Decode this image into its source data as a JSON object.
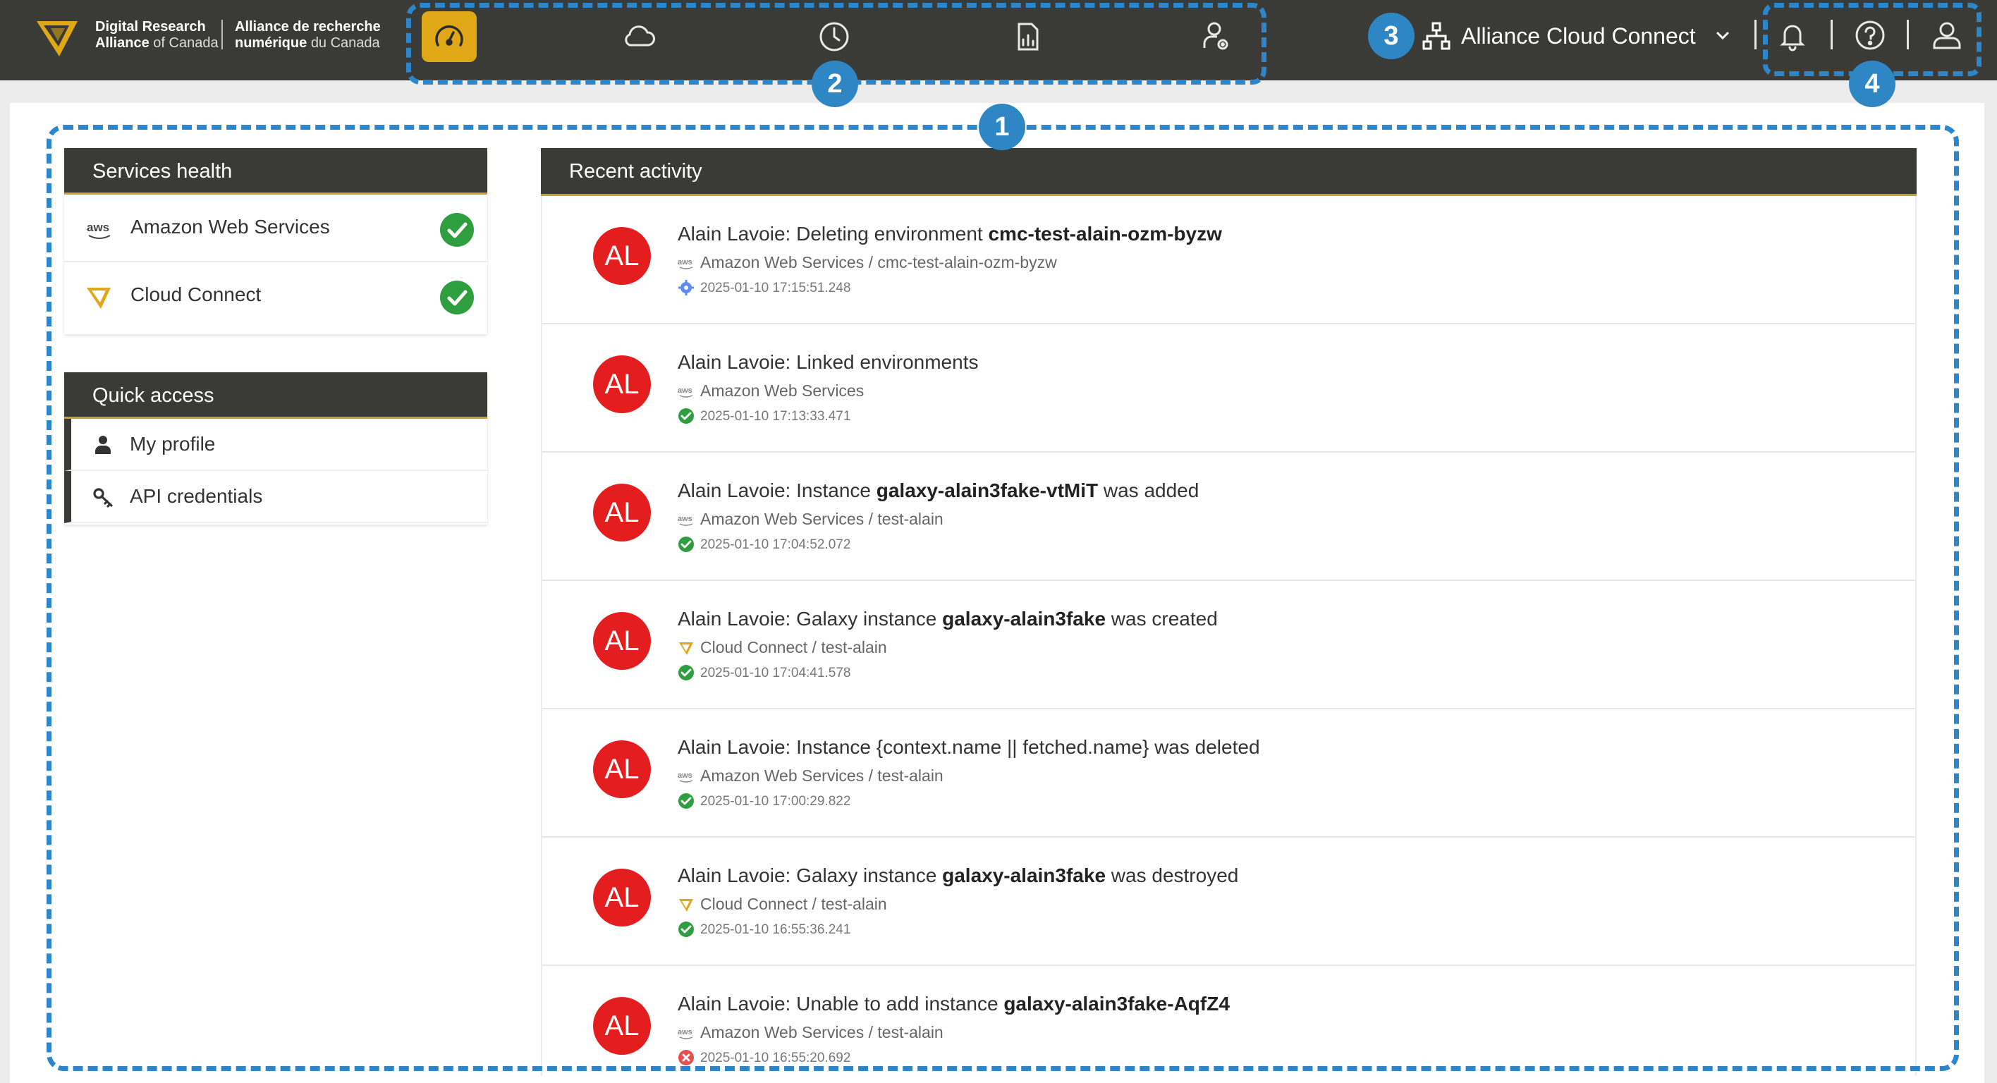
{
  "brand": {
    "en_line1": "Digital Research",
    "en_line2_bold": "Alliance",
    "en_line2_thin": "of Canada",
    "fr_line1": "Alliance de recherche",
    "fr_line2_bold": "numérique",
    "fr_line2_thin": "du Canada"
  },
  "nav": {
    "items": [
      {
        "name": "dashboard",
        "icon": "gauge-icon",
        "active": true
      },
      {
        "name": "cloud",
        "icon": "cloud-icon",
        "active": false
      },
      {
        "name": "history",
        "icon": "clock-icon",
        "active": false
      },
      {
        "name": "reports",
        "icon": "report-icon",
        "active": false
      },
      {
        "name": "admin",
        "icon": "user-settings-icon",
        "active": false
      }
    ]
  },
  "org": {
    "label": "Alliance Cloud Connect",
    "icon": "org-tree-icon"
  },
  "header_right": {
    "icons": [
      "bell-icon",
      "help-icon",
      "user-icon"
    ]
  },
  "services_health": {
    "title": "Services health",
    "items": [
      {
        "label": "Amazon Web Services",
        "icon": "aws-icon",
        "status": "ok"
      },
      {
        "label": "Cloud Connect",
        "icon": "cloud-connect-logo-icon",
        "status": "ok"
      }
    ]
  },
  "quick_access": {
    "title": "Quick access",
    "items": [
      {
        "label": "My profile",
        "icon": "person-icon"
      },
      {
        "label": "API credentials",
        "icon": "key-icon"
      }
    ]
  },
  "recent_activity": {
    "title": "Recent activity",
    "items": [
      {
        "initials": "AL",
        "prefix": "Alain Lavoie: Deleting environment ",
        "strong": "cmc-test-alain-ozm-byzw",
        "suffix": "",
        "service": "Amazon Web Services / cmc-test-alain-ozm-byzw",
        "service_icon": "aws-icon",
        "time": "2025-01-10 17:15:51.248",
        "status": "in-progress"
      },
      {
        "initials": "AL",
        "prefix": "Alain Lavoie: Linked environments",
        "strong": "",
        "suffix": "",
        "service": "Amazon Web Services",
        "service_icon": "aws-icon",
        "time": "2025-01-10 17:13:33.471",
        "status": "success"
      },
      {
        "initials": "AL",
        "prefix": "Alain Lavoie: Instance ",
        "strong": "galaxy-alain3fake-vtMiT",
        "suffix": " was added",
        "service": "Amazon Web Services / test-alain",
        "service_icon": "aws-icon",
        "time": "2025-01-10 17:04:52.072",
        "status": "success"
      },
      {
        "initials": "AL",
        "prefix": "Alain Lavoie: Galaxy instance ",
        "strong": "galaxy-alain3fake",
        "suffix": " was created",
        "service": "Cloud Connect / test-alain",
        "service_icon": "cloud-connect-logo-icon",
        "time": "2025-01-10 17:04:41.578",
        "status": "success"
      },
      {
        "initials": "AL",
        "prefix": "Alain Lavoie: Instance {context.name || fetched.name} was deleted",
        "strong": "",
        "suffix": "",
        "service": "Amazon Web Services / test-alain",
        "service_icon": "aws-icon",
        "time": "2025-01-10 17:00:29.822",
        "status": "success"
      },
      {
        "initials": "AL",
        "prefix": "Alain Lavoie: Galaxy instance ",
        "strong": "galaxy-alain3fake",
        "suffix": " was destroyed",
        "service": "Cloud Connect / test-alain",
        "service_icon": "cloud-connect-logo-icon",
        "time": "2025-01-10 16:55:36.241",
        "status": "success"
      },
      {
        "initials": "AL",
        "prefix": "Alain Lavoie: Unable to add instance ",
        "strong": "galaxy-alain3fake-AqfZ4",
        "suffix": "",
        "service": "Amazon Web Services / test-alain",
        "service_icon": "aws-icon",
        "time": "2025-01-10 16:55:20.692",
        "status": "error"
      }
    ]
  },
  "annotations": [
    {
      "label": "1"
    },
    {
      "label": "2"
    },
    {
      "label": "3"
    },
    {
      "label": "4"
    }
  ],
  "colors": {
    "topbar": "#3a3a37",
    "accent": "#e0a817",
    "avatar": "#e41e1e",
    "ok": "#2e9e3e",
    "annotation": "#2f86c4"
  }
}
